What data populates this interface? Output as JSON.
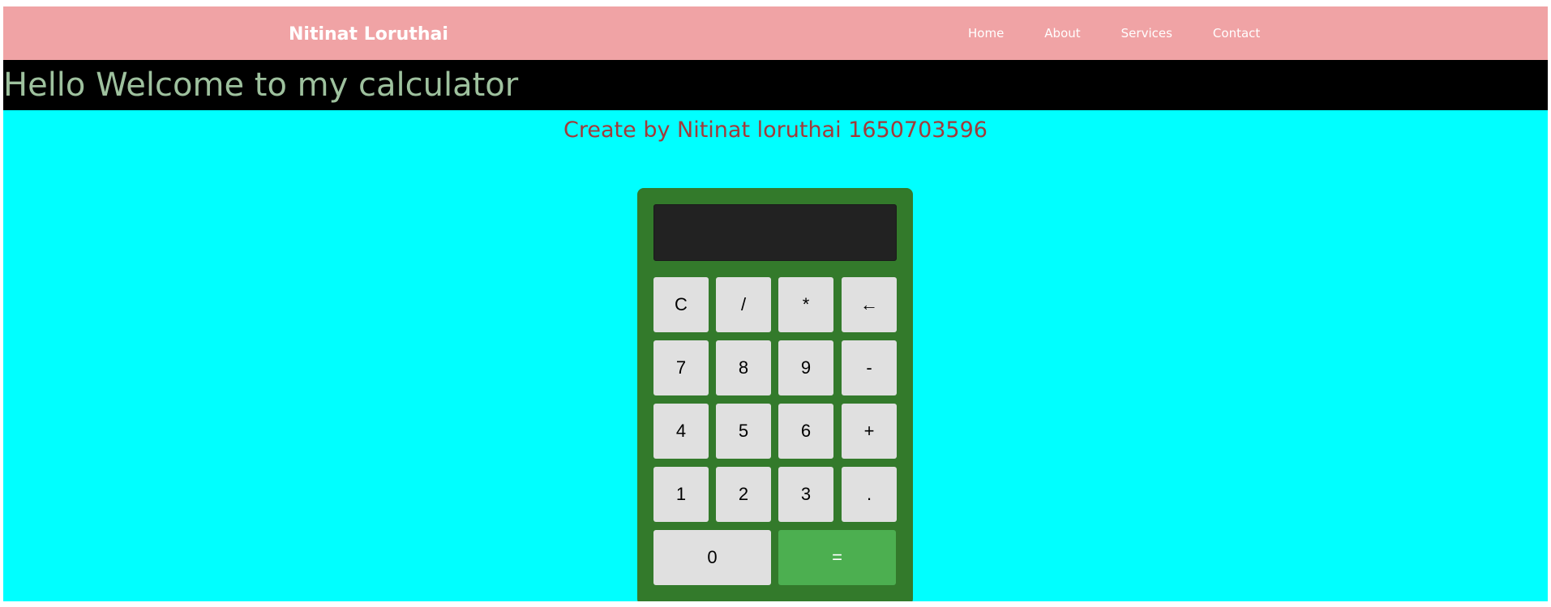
{
  "navbar": {
    "brand": "Nitinat Loruthai",
    "links": [
      {
        "label": "Home"
      },
      {
        "label": "About"
      },
      {
        "label": "Services"
      },
      {
        "label": "Contact"
      }
    ]
  },
  "banner": {
    "title": "Hello Welcome to my calculator"
  },
  "main": {
    "subtitle": "Create by Nitinat loruthai 1650703596"
  },
  "calculator": {
    "display_value": "",
    "keys": {
      "clear": "C",
      "divide": "/",
      "multiply": "*",
      "backspace": "←",
      "seven": "7",
      "eight": "8",
      "nine": "9",
      "minus": "-",
      "four": "4",
      "five": "5",
      "six": "6",
      "plus": "+",
      "one": "1",
      "two": "2",
      "three": "3",
      "decimal": ".",
      "zero": "0",
      "equals": "="
    }
  },
  "colors": {
    "navbar_bg": "#f0a3a5",
    "banner_bg": "#000000",
    "banner_text": "#9ec19e",
    "main_bg": "#00ffff",
    "subtitle_text": "#a33a3a",
    "calculator_bg": "#337a2b",
    "display_bg": "#222222",
    "key_bg": "#e0e0e0",
    "equals_bg": "#4caf50"
  }
}
